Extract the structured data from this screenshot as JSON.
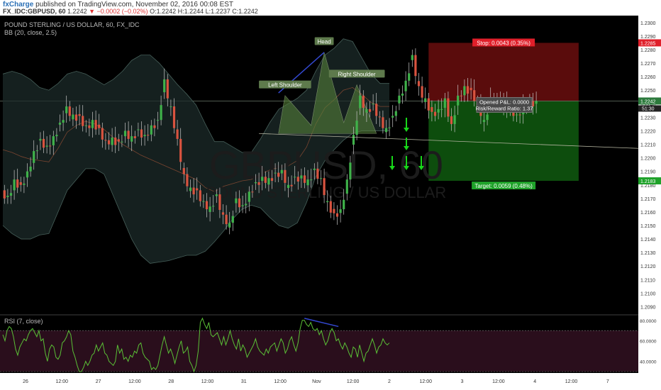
{
  "header": {
    "publisher": "fxCharge",
    "published_text": "published on TradingView.com, November 02, 2016 00:08 EST",
    "symbol": "FX_IDC:GBPUSD, 60",
    "last": "1.2242",
    "change": "▼ −0.0002 (−0.02%)",
    "ohlc": {
      "o": "O:1.2242",
      "h": "H:1.2244",
      "l": "L:1.2237",
      "c": "C:1.2242"
    }
  },
  "colors": {
    "background": "#000000",
    "up": "#3fb24a",
    "down": "#d9533f",
    "band_fill": "#1c2b2a",
    "stop_zone": "#5a0c0c",
    "target_zone": "#0d4d0d",
    "arrow": "#18d61a",
    "rsi_line": "#5ac036",
    "rsi_band": "#2a0e1c",
    "divergence": "#3348d0",
    "pattern_fill": "#557f3a",
    "text": "#b4b4b4"
  },
  "chart_data": [
    {
      "type": "candlestick",
      "title": "POUND STERLING / US DOLLAR, 60, FX_IDC",
      "indicator_label": "BB (20, close, 2.5)",
      "watermark": "GBPUSD, 60",
      "watermark_sub": "POUND STERLING / US DOLLAR",
      "y_ticks": [
        "1.2300",
        "1.2290",
        "1.2280",
        "1.2270",
        "1.2260",
        "1.2250",
        "1.2240",
        "1.2230",
        "1.2220",
        "1.2210",
        "1.2200",
        "1.2190",
        "1.2180",
        "1.2170",
        "1.2160",
        "1.2150",
        "1.2140",
        "1.2130",
        "1.2120",
        "1.2110",
        "1.2100",
        "1.2090"
      ],
      "ylim": [
        1.2085,
        1.2302
      ],
      "x_ticks": [
        "26",
        "12:00",
        "27",
        "12:00",
        "28",
        "12:00",
        "31",
        "12:00",
        "Nov",
        "12:00",
        "2",
        "12:00",
        "3",
        "12:00",
        "4",
        "12:00",
        "7"
      ],
      "last_price": "1.2242",
      "countdown": "51:30",
      "stop_price": "1.2285",
      "target_price": "1.2183",
      "entry_price": 1.2242,
      "trendline": [
        [
          39,
          1.2218
        ],
        [
          83,
          1.2207
        ]
      ],
      "patterns": {
        "left_shoulder": "Left Shoulder",
        "head": "Head",
        "right_shoulder": "Right Shoulder"
      },
      "position": {
        "stop_label": "Stop: 0.0043 (0.35%)",
        "target_label": "Target: 0.0059 (0.48%)",
        "pnl_label": "Opened P&L: 0.0000",
        "rr_label": "Risk/Reward Ratio: 1.37"
      },
      "closes": [
        1.2172,
        1.2184,
        1.218,
        1.219,
        1.2205,
        1.2214,
        1.2209,
        1.2216,
        1.2226,
        1.2238,
        1.2232,
        1.2231,
        1.2224,
        1.2228,
        1.2222,
        1.2213,
        1.2215,
        1.2212,
        1.222,
        1.2216,
        1.2221,
        1.2217,
        1.2224,
        1.2228,
        1.2258,
        1.2238,
        1.2214,
        1.2188,
        1.2178,
        1.2176,
        1.2168,
        1.2164,
        1.2173,
        1.2158,
        1.2152,
        1.217,
        1.2165,
        1.2175,
        1.2182,
        1.2186,
        1.2185,
        1.2189,
        1.2191,
        1.218,
        1.2186,
        1.2187,
        1.2184,
        1.2192,
        1.2185,
        1.2168,
        1.2159,
        1.2162,
        1.2184,
        1.2217,
        1.2246,
        1.2236,
        1.224,
        1.223,
        1.2222,
        1.2231,
        1.2246,
        1.2257,
        1.2276,
        1.2253,
        1.2244,
        1.2234,
        1.2236,
        1.2244,
        1.2225,
        1.2246,
        1.2253,
        1.225,
        1.2242,
        1.2228,
        1.2244,
        1.2243,
        1.2241,
        1.2238,
        1.2232,
        1.2239,
        1.2242,
        1.2242
      ],
      "lines": [
        {
          "name": "",
          "role": "upper",
          "values": [
            1.2262,
            1.2264,
            1.2262,
            1.2258,
            1.2252,
            1.225,
            1.2255,
            1.2262,
            1.2264,
            1.2262,
            1.2258,
            1.2254,
            1.2258,
            1.2264,
            1.2272,
            1.2276,
            1.2276,
            1.227,
            1.2262,
            1.2254,
            1.2247,
            1.2239,
            1.2225,
            1.2212,
            1.2212,
            1.2208,
            1.2204,
            1.2204,
            1.2214,
            1.2226,
            1.2236,
            1.224,
            1.2244,
            1.225,
            1.2264,
            1.2276,
            1.2281,
            1.2288,
            1.2286,
            1.2274,
            1.2262,
            1.2255,
            1.2255
          ]
        },
        {
          "name": "",
          "role": "lower",
          "values": [
            1.215,
            1.2144,
            1.214,
            1.214,
            1.2143,
            1.2144,
            1.216,
            1.2176,
            1.2184,
            1.2192,
            1.2192,
            1.2188,
            1.2172,
            1.2156,
            1.214,
            1.2128,
            1.2122,
            1.2123,
            1.2124,
            1.2126,
            1.2128,
            1.2128,
            1.2131,
            1.2138,
            1.2146,
            1.2155,
            1.2162,
            1.2165,
            1.2163,
            1.2156,
            1.215,
            1.2148,
            1.2152,
            1.2167,
            1.2186,
            1.2198,
            1.2206,
            1.2213,
            1.2218,
            1.222,
            1.222,
            1.222,
            1.222
          ]
        },
        {
          "name": "",
          "role": "mid",
          "values": [
            1.2206,
            1.2204,
            1.2201,
            1.2199,
            1.2198,
            1.2197,
            1.2207,
            1.2219,
            1.2224,
            1.2227,
            1.2225,
            1.2221,
            1.2215,
            1.221,
            1.2206,
            1.2202,
            1.2199,
            1.2196,
            1.2193,
            1.219,
            1.2187,
            1.2184,
            1.2178,
            1.2175,
            1.2179,
            1.2181,
            1.2183,
            1.2184,
            1.2188,
            1.2191,
            1.2193,
            1.2194,
            1.2198,
            1.2208,
            1.2225,
            1.2237,
            1.2243,
            1.225,
            1.2252,
            1.2247,
            1.2241,
            1.2238,
            1.2238
          ]
        }
      ]
    },
    {
      "type": "line",
      "title": "RSI (7, close)",
      "y_ticks": [
        "80.0000",
        "60.0000",
        "40.0000"
      ],
      "ylim": [
        30,
        84
      ],
      "upper_level": 70,
      "lower_level": 30,
      "series": [
        {
          "name": "",
          "values": [
            66,
            60,
            70,
            74,
            72,
            64,
            52,
            46,
            54,
            58,
            62,
            60,
            66,
            70,
            72,
            68,
            64,
            70,
            60,
            62,
            48,
            40,
            52,
            56,
            54,
            44,
            42,
            46,
            58,
            60,
            64,
            70,
            66,
            50,
            44,
            36,
            30,
            30,
            34,
            40,
            36,
            40,
            46,
            48,
            56,
            50,
            54,
            58,
            48,
            46,
            40,
            38,
            36,
            40,
            56,
            48,
            52,
            42,
            44,
            40,
            46,
            44,
            50,
            48,
            56,
            58,
            48,
            44,
            42,
            40,
            32,
            34,
            32,
            36,
            46,
            56,
            64,
            56,
            48,
            52,
            46,
            38,
            46,
            54,
            60,
            48,
            50,
            54,
            40,
            36,
            30,
            36,
            50,
            78,
            82,
            76,
            72,
            78,
            66,
            64,
            66,
            68,
            62,
            56,
            64,
            56,
            62,
            70,
            62,
            56,
            52,
            62,
            50,
            56,
            52,
            44,
            48,
            52,
            56,
            62,
            54,
            50,
            48,
            46,
            52,
            48,
            54,
            56,
            58,
            50,
            56,
            62,
            58,
            48,
            52,
            60,
            64,
            56,
            50,
            58,
            72,
            80,
            80,
            76,
            74,
            78,
            72,
            70,
            72,
            66,
            70,
            62,
            56,
            60,
            68,
            72,
            68,
            60,
            62,
            56,
            52,
            58,
            54,
            48,
            44,
            54,
            52,
            44,
            56,
            48,
            40,
            48,
            50,
            56,
            62,
            56,
            48,
            54,
            56,
            62,
            58,
            56,
            58
          ]
        }
      ]
    }
  ]
}
